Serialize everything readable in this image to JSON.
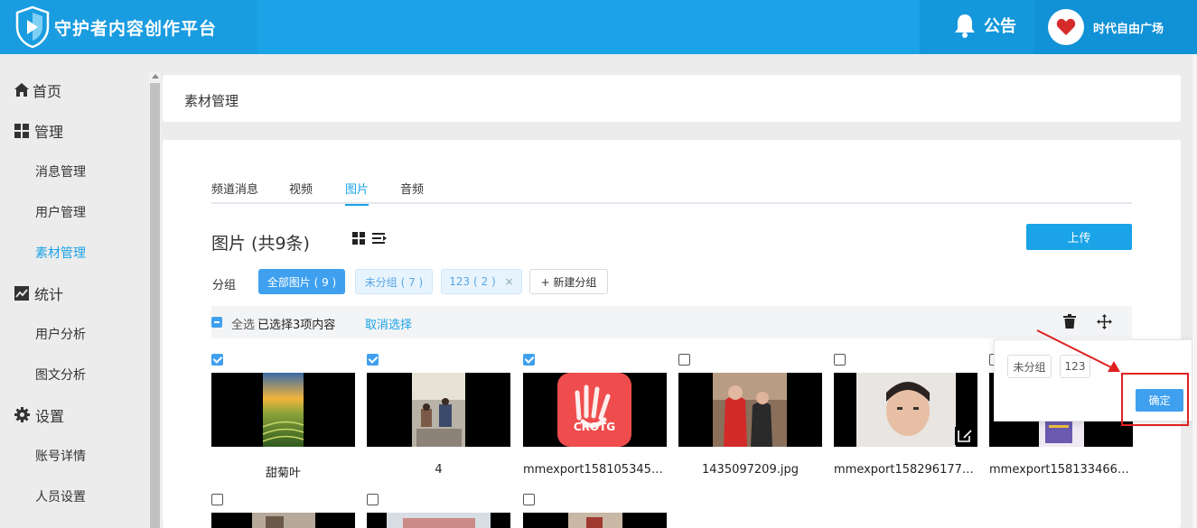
{
  "header": {
    "app_title": "守护者内容创作平台",
    "notice_label": "公告",
    "user_name": "时代自由广场"
  },
  "sidebar": {
    "items": [
      {
        "label": "首页",
        "icon": "home-icon",
        "level": "top"
      },
      {
        "label": "管理",
        "icon": "grid-icon",
        "level": "top"
      },
      {
        "label": "消息管理",
        "level": "sub"
      },
      {
        "label": "用户管理",
        "level": "sub"
      },
      {
        "label": "素材管理",
        "level": "sub",
        "active": true
      },
      {
        "label": "统计",
        "icon": "chart-icon",
        "level": "top"
      },
      {
        "label": "用户分析",
        "level": "sub"
      },
      {
        "label": "图文分析",
        "level": "sub"
      },
      {
        "label": "设置",
        "icon": "gear-icon",
        "level": "top"
      },
      {
        "label": "账号详情",
        "level": "sub"
      },
      {
        "label": "人员设置",
        "level": "sub"
      }
    ]
  },
  "page": {
    "title": "素材管理"
  },
  "tabs": [
    {
      "label": "频道消息"
    },
    {
      "label": "视频"
    },
    {
      "label": "图片",
      "active": true
    },
    {
      "label": "音频"
    }
  ],
  "section": {
    "title": "图片 (共9条)",
    "upload_label": "上传"
  },
  "groups": {
    "label": "分组",
    "chips": [
      {
        "label": "全部图片 ( 9 )",
        "style": "primary"
      },
      {
        "label": "未分组 ( 7 )",
        "style": "light"
      },
      {
        "label": "123 ( 2 )",
        "style": "light",
        "closable": "×"
      },
      {
        "label": "+ 新建分组",
        "style": "plain"
      }
    ]
  },
  "selection": {
    "select_all": "全选",
    "selected_text": "已选择3项内容",
    "cancel": "取消选择"
  },
  "images": [
    {
      "caption": "甜菊叶",
      "checked": true
    },
    {
      "caption": "4",
      "checked": true
    },
    {
      "caption": "mmexport15810534500...",
      "checked": true
    },
    {
      "caption": "1435097209.jpg",
      "checked": false
    },
    {
      "caption": "mmexport15829617764...",
      "checked": false
    },
    {
      "caption": "mmexport15813346694...",
      "checked": false
    },
    {
      "caption": "",
      "checked": false
    },
    {
      "caption": "",
      "checked": false
    },
    {
      "caption": "",
      "checked": false
    }
  ],
  "move_popover": {
    "options": [
      "未分组",
      "123"
    ],
    "confirm": "确定"
  },
  "colors": {
    "brand_blue": "#1aa3e6",
    "annotation_red": "#e02020"
  }
}
